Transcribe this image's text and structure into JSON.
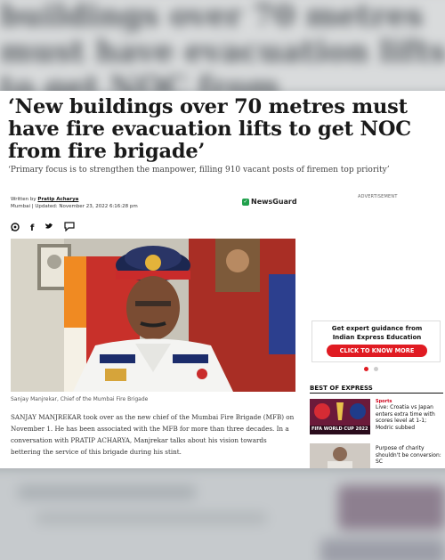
{
  "background": {
    "ghost_text": "buildings over 70 metres must have evacuation lifts to get NOC from"
  },
  "article": {
    "headline": "‘New buildings over 70 metres must have fire evacuation lifts to get NOC from fire brigade’",
    "subhead": "‘Primary focus is to strengthen the manpower, filling 910 vacant posts of firemen top priority’",
    "written_by_label": "Written by",
    "author": "Pratip Acharya",
    "location_updated": "Mumbai | Updated: November 23, 2022 6:16:28 pm",
    "newsguard": "NewsGuard",
    "advertisement_label": "ADVERTISEMENT",
    "image_caption": "Sanjay Manjrekar, Chief of the Mumbai Fire Brigade",
    "body": "SANJAY MANJREKAR took over as the new chief of the Mumbai Fire Brigade (MFB) on November 1. He has been associated with the MFB for more than three decades. In a conversation with PRATIP ACHARYA, Manjrekar talks about his vision towards bettering the service of this brigade during his stint."
  },
  "share_icons": [
    "whatsapp-icon",
    "facebook-icon",
    "twitter-icon",
    "comment-icon"
  ],
  "rail": {
    "ad_line1": "Get expert guidance from",
    "ad_line2": "Indian Express Education",
    "ad_cta": "CLICK TO KNOW MORE",
    "section_title": "BEST OF EXPRESS",
    "stories": [
      {
        "kicker": "Sports",
        "title": "Live: Croatia vs Japan enters extra time with scores level at 1-1; Modric subbed",
        "thumb_text": "FIFA WORLD CUP 2022"
      },
      {
        "kicker": "",
        "title": "Purpose of charity shouldn't be conversion: SC",
        "thumb_text": ""
      }
    ]
  },
  "colors": {
    "accent_red": "#e01b22",
    "newsguard_green": "#20a04b"
  }
}
